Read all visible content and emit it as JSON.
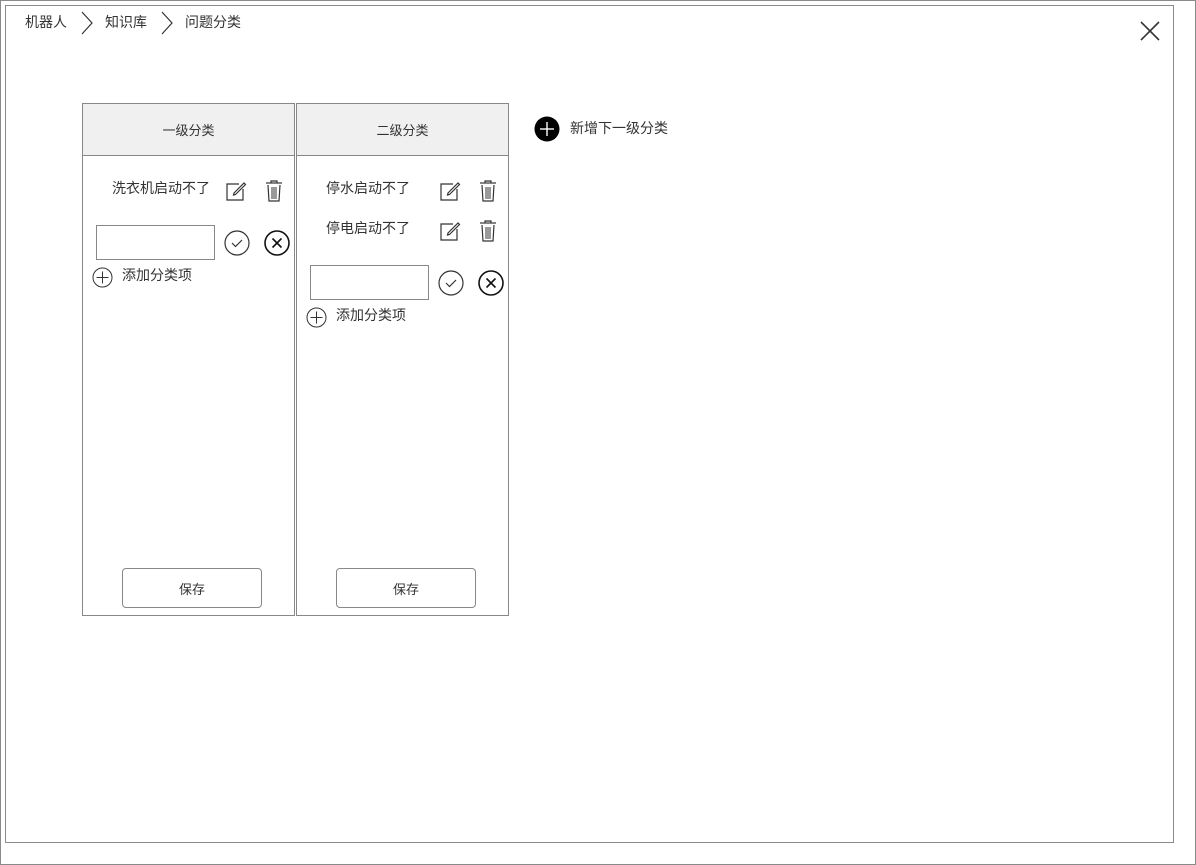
{
  "breadcrumb": [
    "机器人",
    "知识库",
    "问题分类"
  ],
  "panels": [
    {
      "header": "一级分类",
      "items": [
        "洗衣机启动不了"
      ],
      "input_value": "",
      "add_label": "添加分类项",
      "save_label": "保存"
    },
    {
      "header": "二级分类",
      "items": [
        "停水启动不了",
        "停电启动不了"
      ],
      "input_value": "",
      "add_label": "添加分类项",
      "save_label": "保存"
    }
  ],
  "new_level_label": "新增下一级分类",
  "icons": {
    "close": "close-icon",
    "breadcrumb_separator": "chevron-right-icon",
    "edit": "edit-icon",
    "delete": "trash-icon",
    "confirm": "check-circle-icon",
    "cancel": "x-circle-icon",
    "add": "plus-circle-icon",
    "new_level": "plus-circle-filled-icon"
  }
}
